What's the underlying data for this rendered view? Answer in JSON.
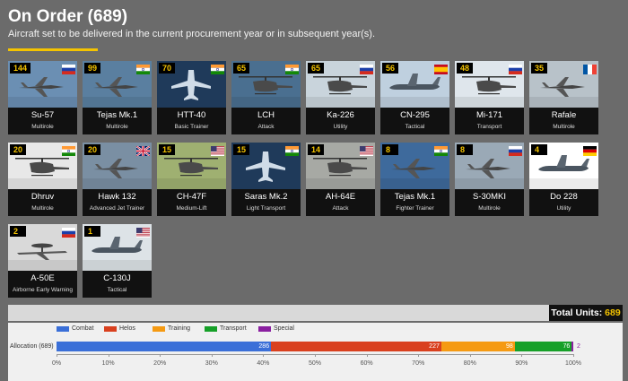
{
  "header": {
    "title": "On Order (689)",
    "subtitle": "Aircraft set to be delivered in the current procurement year or in subsequent year(s)."
  },
  "aircraft": [
    {
      "count": "144",
      "name": "Su-57",
      "role": "Multirole",
      "flag": "russia",
      "icon": "fighter-jet-icon",
      "bg": "#6b8fb3"
    },
    {
      "count": "99",
      "name": "Tejas Mk.1",
      "role": "Multirole",
      "flag": "india",
      "icon": "fighter-jet-icon",
      "bg": "#5a7fa0"
    },
    {
      "count": "70",
      "name": "HTT-40",
      "role": "Basic Trainer",
      "flag": "india",
      "icon": "aircraft-silhouette-icon",
      "bg": "#1f3a5a"
    },
    {
      "count": "65",
      "name": "LCH",
      "role": "Attack",
      "flag": "india",
      "icon": "helicopter-icon",
      "bg": "#4a6f90"
    },
    {
      "count": "65",
      "name": "Ka-226",
      "role": "Utility",
      "flag": "russia",
      "icon": "helicopter-icon",
      "bg": "#c9d4dc"
    },
    {
      "count": "56",
      "name": "CN-295",
      "role": "Tactical",
      "flag": "spain",
      "icon": "transport-plane-icon",
      "bg": "#bfd0df"
    },
    {
      "count": "48",
      "name": "Mi-171",
      "role": "Transport",
      "flag": "russia",
      "icon": "helicopter-icon",
      "bg": "#dfe6ec"
    },
    {
      "count": "35",
      "name": "Rafale",
      "role": "Multirole",
      "flag": "france",
      "icon": "fighter-jet-icon",
      "bg": "#b8c2c9"
    },
    {
      "count": "20",
      "name": "Dhruv",
      "role": "Multirole",
      "flag": "india",
      "icon": "helicopter-icon",
      "bg": "#e8e8e8"
    },
    {
      "count": "20",
      "name": "Hawk 132",
      "role": "Advanced Jet Trainer",
      "flag": "uk",
      "icon": "fighter-jet-icon",
      "bg": "#7a8fa3"
    },
    {
      "count": "15",
      "name": "CH-47F",
      "role": "Medium-Lift",
      "flag": "usa",
      "icon": "helicopter-icon",
      "bg": "#9fb071"
    },
    {
      "count": "15",
      "name": "Saras Mk.2",
      "role": "Light Transport",
      "flag": "india",
      "icon": "aircraft-silhouette-icon",
      "bg": "#1f3a5a"
    },
    {
      "count": "14",
      "name": "AH-64E",
      "role": "Attack",
      "flag": "usa",
      "icon": "helicopter-icon",
      "bg": "#a7a9a4"
    },
    {
      "count": "8",
      "name": "Tejas Mk.1",
      "role": "Fighter Trainer",
      "flag": "india",
      "icon": "fighter-jet-icon",
      "bg": "#3e6a9c"
    },
    {
      "count": "8",
      "name": "S-30MKI",
      "role": "Multirole",
      "flag": "russia",
      "icon": "fighter-jet-icon",
      "bg": "#9aa9b6"
    },
    {
      "count": "4",
      "name": "Do 228",
      "role": "Utility",
      "flag": "germany",
      "icon": "transport-plane-icon",
      "bg": "#ffffff"
    },
    {
      "count": "2",
      "name": "A-50E",
      "role": "Airborne Early Warning",
      "flag": "russia",
      "icon": "awacs-plane-icon",
      "bg": "#d9d9d9"
    },
    {
      "count": "1",
      "name": "C-130J",
      "role": "Tactical",
      "flag": "usa",
      "icon": "transport-plane-icon",
      "bg": "#dde3e7"
    }
  ],
  "totals": {
    "label": "Total Units:",
    "value": "689"
  },
  "allocation": {
    "label": "Allocation (689)",
    "total": 689,
    "legend": [
      {
        "name": "Combat",
        "color": "#3a6fd8"
      },
      {
        "name": "Helos",
        "color": "#d9401e"
      },
      {
        "name": "Training",
        "color": "#f59a12"
      },
      {
        "name": "Transport",
        "color": "#16a028"
      },
      {
        "name": "Special",
        "color": "#8a1fa0"
      }
    ],
    "segments": [
      {
        "name": "Combat",
        "value": 286,
        "label": "286",
        "color": "#3a6fd8"
      },
      {
        "name": "Helos",
        "value": 227,
        "label": "227",
        "color": "#d9401e"
      },
      {
        "name": "Training",
        "value": 98,
        "label": "98",
        "color": "#f59a12"
      },
      {
        "name": "Transport",
        "value": 76,
        "label": "76",
        "color": "#16a028"
      },
      {
        "name": "Special",
        "value": 2,
        "label": "2",
        "color": "#8a1fa0"
      }
    ],
    "ticks": [
      "0%",
      "10%",
      "20%",
      "30%",
      "40%",
      "50%",
      "60%",
      "70%",
      "80%",
      "90%",
      "100%"
    ]
  }
}
